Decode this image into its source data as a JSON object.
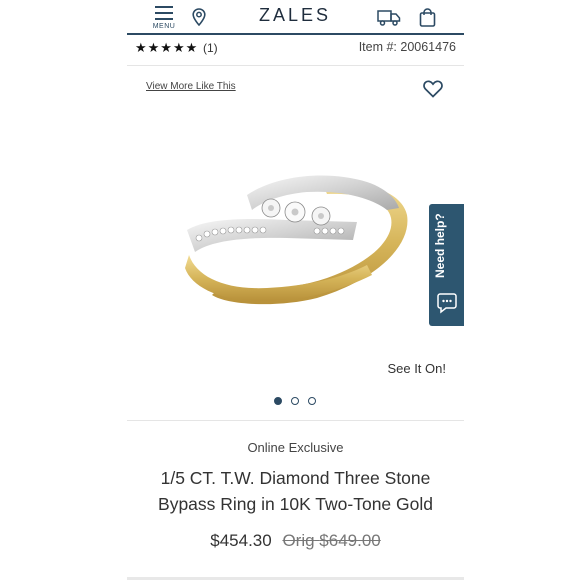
{
  "header": {
    "menu_label": "MENU",
    "logo": "ZALES"
  },
  "rating": {
    "stars": "★★★★★",
    "review_count": "(1)",
    "item_label": "Item #: ",
    "item_number": "20061476"
  },
  "gallery": {
    "view_more": "View More Like This",
    "see_it_on": "See It On!",
    "need_help": "Need help?",
    "slide_count": 3,
    "active_slide": 1
  },
  "product": {
    "badge": "Online Exclusive",
    "title": "1/5 CT. T.W. Diamond Three Stone Bypass Ring in 10K Two-Tone Gold",
    "price": "$454.30",
    "orig_label": "Orig",
    "orig_price": "$649.00"
  },
  "colors": {
    "brand_navy": "#2c4a63",
    "help_tab": "#2d5670",
    "gold": "#d8b85a",
    "white_gold": "#dcdcdc"
  },
  "icons": [
    "menu-icon",
    "location-pin-icon",
    "truck-icon",
    "shopping-bag-icon",
    "heart-icon",
    "chat-bubble-icon"
  ]
}
